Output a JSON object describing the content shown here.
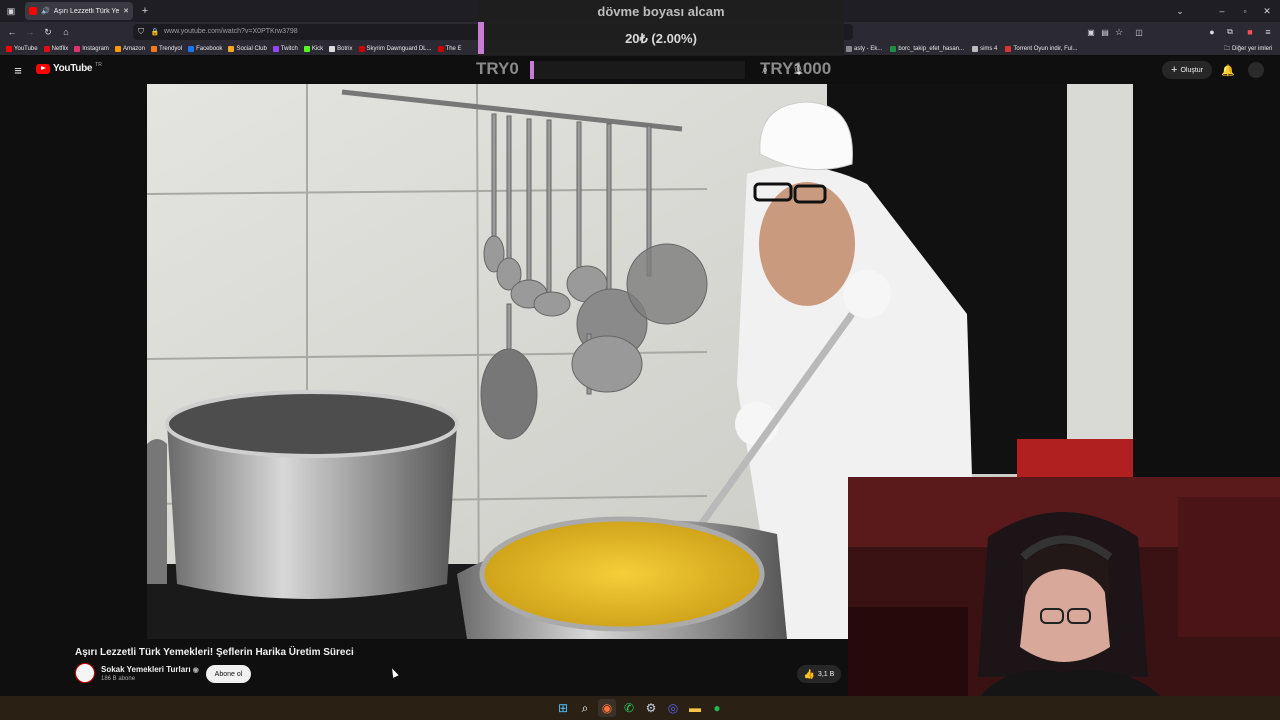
{
  "browser": {
    "tab_title": "Aşırı Lezzetli Türk Yemekleri",
    "url": "www.youtube.com/watch?v=X0PTKrw3798",
    "bookmarks": [
      {
        "label": "YouTube",
        "color": "#ff0000"
      },
      {
        "label": "Netflix",
        "color": "#e50914"
      },
      {
        "label": "Instagram",
        "color": "#e1306c"
      },
      {
        "label": "Amazon",
        "color": "#ff9900"
      },
      {
        "label": "Trendyol",
        "color": "#f27a1a"
      },
      {
        "label": "Facebook",
        "color": "#1877f2"
      },
      {
        "label": "Social Club",
        "color": "#f5a623"
      },
      {
        "label": "Twitch",
        "color": "#9146ff"
      },
      {
        "label": "Kick",
        "color": "#53fc18"
      },
      {
        "label": "Botrix",
        "color": "#dddddd"
      },
      {
        "label": "Skyrim Dawnguard DL...",
        "color": "#cc0000"
      },
      {
        "label": "The E",
        "color": "#cc0000"
      }
    ],
    "bookmarks_right": [
      {
        "label": "asty - Ek...",
        "color": "#888888"
      },
      {
        "label": "borc_takip_efet_hasan...",
        "color": "#1e8e3e"
      },
      {
        "label": "sims 4",
        "color": "#bbbbbb"
      },
      {
        "label": "Torrent Oyun indir, Ful...",
        "color": "#d33"
      }
    ],
    "other_bookmarks": "Diğer yer imleri"
  },
  "overlay": {
    "message": "dövme boyası alcam",
    "amount": "20₺ (2.00%)",
    "goal_start": "TRY0",
    "goal_end": "TRY1000",
    "progress": 0.02,
    "accent": "#c77dd3"
  },
  "youtube": {
    "logo_text": "YouTube",
    "region": "TR",
    "create_label": "Oluştur",
    "video_title": "Aşırı Lezzetli Türk Yemekleri! Şeflerin Harika Üretim Süreci",
    "channel_name": "Sokak Yemekleri Turları",
    "subscribers": "186 B abone",
    "subscribe_label": "Abone ol",
    "likes": "3,1 B"
  },
  "taskbar": {
    "icons": [
      "windows-start-icon",
      "search-icon",
      "firefox-icon",
      "whatsapp-icon",
      "steam-icon",
      "discord-icon",
      "file-explorer-icon",
      "spotify-icon"
    ]
  }
}
